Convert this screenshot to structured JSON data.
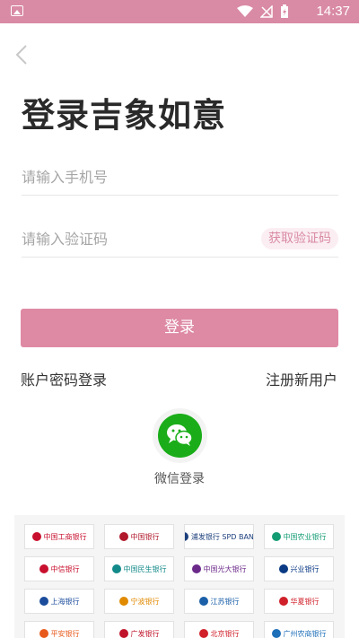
{
  "status_bar": {
    "time": "14:37"
  },
  "title": "登录吉象如意",
  "phone": {
    "placeholder": "请输入手机号"
  },
  "code": {
    "placeholder": "请输入验证码",
    "button": "获取验证码"
  },
  "login_button": "登录",
  "links": {
    "password_login": "账户密码登录",
    "register": "注册新用户"
  },
  "wechat": {
    "label": "微信登录"
  },
  "colors": {
    "accent": "#de8aa5",
    "status_bar": "#d98aa4",
    "wechat_green": "#1aad19"
  },
  "banks": [
    {
      "name": "中国工商银行",
      "color": "#c8102e"
    },
    {
      "name": "中国银行",
      "color": "#b0182b"
    },
    {
      "name": "浦发银行 SPD BANK",
      "color": "#1c3f7c"
    },
    {
      "name": "中国农业银行",
      "color": "#139c74"
    },
    {
      "name": "中信银行",
      "color": "#c8102e"
    },
    {
      "name": "中国民生银行",
      "color": "#138a8a"
    },
    {
      "name": "中国光大银行",
      "color": "#6b2a8a"
    },
    {
      "name": "兴业银行",
      "color": "#0a3a84"
    },
    {
      "name": "上海银行",
      "color": "#1b4c9c"
    },
    {
      "name": "宁波银行",
      "color": "#e08a00"
    },
    {
      "name": "江苏银行",
      "color": "#1a5fa8"
    },
    {
      "name": "华夏银行",
      "color": "#d0202a"
    },
    {
      "name": "平安银行",
      "color": "#e85a1c"
    },
    {
      "name": "广发银行",
      "color": "#c0142a"
    },
    {
      "name": "北京银行",
      "color": "#d0202a"
    },
    {
      "name": "广州农商银行",
      "color": "#1d6fb8"
    }
  ]
}
